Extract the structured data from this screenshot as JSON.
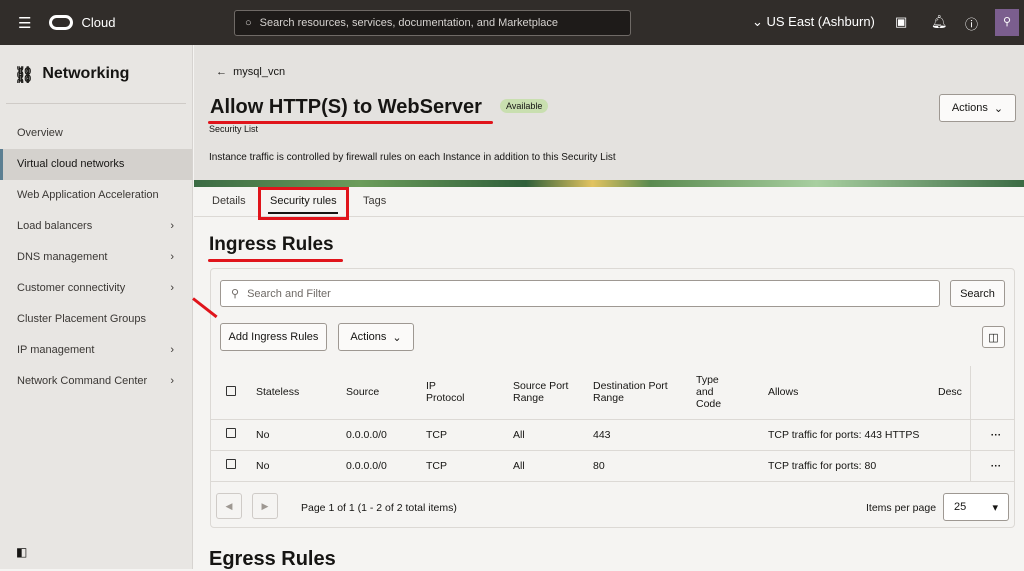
{
  "topbar": {
    "brand": "Cloud",
    "search_placeholder": "Search resources, services, documentation, and Marketplace",
    "region": "US East (Ashburn)"
  },
  "sidebar": {
    "title": "Networking",
    "items": [
      {
        "label": "Overview",
        "chev": false
      },
      {
        "label": "Virtual cloud networks",
        "chev": false,
        "active": true
      },
      {
        "label": "Web Application Acceleration",
        "chev": false
      },
      {
        "label": "Load balancers",
        "chev": true
      },
      {
        "label": "DNS management",
        "chev": true
      },
      {
        "label": "Customer connectivity",
        "chev": true
      },
      {
        "label": "Cluster Placement Groups",
        "chev": false
      },
      {
        "label": "IP management",
        "chev": true
      },
      {
        "label": "Network Command Center",
        "chev": true
      }
    ]
  },
  "header": {
    "back": "mysql_vcn",
    "title": "Allow HTTP(S) to WebServer",
    "status": "Available",
    "subtitle": "Security List",
    "description": "Instance traffic is controlled by firewall rules on each Instance in addition to this Security List",
    "actions": "Actions"
  },
  "tabs": [
    "Details",
    "Security rules",
    "Tags"
  ],
  "ingress": {
    "title": "Ingress Rules",
    "search_placeholder": "Search and Filter",
    "search_btn": "Search",
    "add_btn": "Add Ingress Rules",
    "actions": "Actions",
    "columns": [
      "Stateless",
      "Source",
      "IP Protocol",
      "Source Port Range",
      "Destination Port Range",
      "Type and Code",
      "Allows",
      "Desc"
    ],
    "rows": [
      [
        "No",
        "0.0.0.0/0",
        "TCP",
        "All",
        "443",
        "",
        "TCP traffic for ports: 443 HTTPS",
        ""
      ],
      [
        "No",
        "0.0.0.0/0",
        "TCP",
        "All",
        "80",
        "",
        "TCP traffic for ports: 80",
        ""
      ]
    ],
    "pagination": "Page 1 of 1 (1 - 2 of 2 total items)",
    "items_per_page_label": "Items per page",
    "items_per_page": "25"
  },
  "egress": {
    "title": "Egress Rules"
  }
}
